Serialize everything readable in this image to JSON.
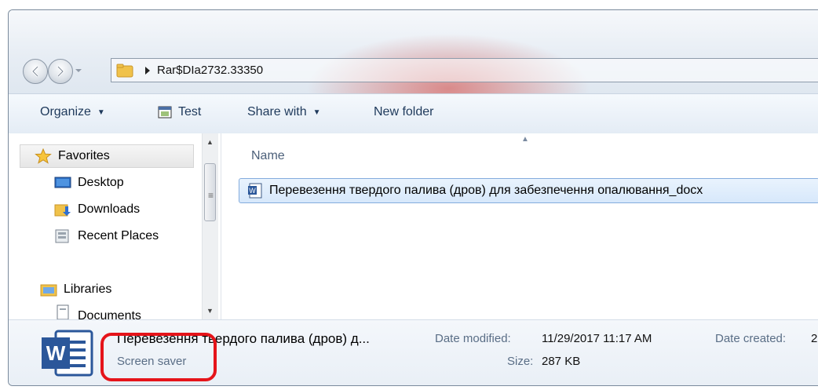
{
  "address": {
    "path": "Rar$DIa2732.33350"
  },
  "toolbar": {
    "organize": "Organize",
    "test": "Test",
    "share_with": "Share with",
    "new_folder": "New folder"
  },
  "nav": {
    "favorites": "Favorites",
    "items": [
      "Desktop",
      "Downloads",
      "Recent Places"
    ],
    "libraries": "Libraries",
    "documents": "Documents"
  },
  "list": {
    "column_name": "Name",
    "file_name": "Перевезення твердого палива (дров) для забезпечення опалювання_docx"
  },
  "details": {
    "name": "Перевезення твердого палива (дров) д...",
    "type": "Screen saver",
    "date_modified_label": "Date modified:",
    "date_modified": "11/29/2017 11:17 AM",
    "size_label": "Size:",
    "size": "287 KB",
    "date_created_label": "Date created:",
    "date_created_partial": "2"
  },
  "colors": {
    "highlight": "#e5141a",
    "word_blue": "#2b579a",
    "selection": "#d7e8fb"
  }
}
